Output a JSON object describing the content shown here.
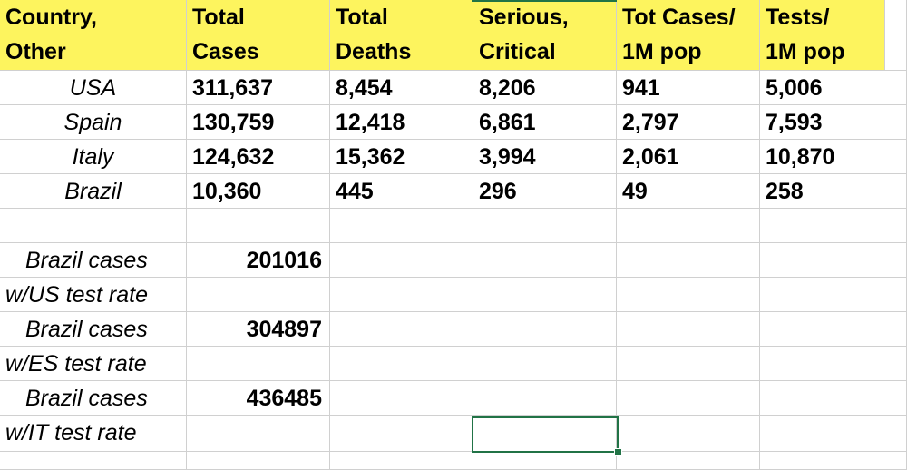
{
  "header": {
    "country": [
      "Country,",
      "Other"
    ],
    "total_cases": [
      "Total",
      "Cases"
    ],
    "total_deaths": [
      "Total",
      "Deaths"
    ],
    "serious": [
      "Serious,",
      "Critical"
    ],
    "tot_cases_1m": [
      "Tot Cases/",
      "1M pop"
    ],
    "tests_1m": [
      "Tests/",
      "1M pop"
    ]
  },
  "rows": [
    {
      "country": "USA",
      "total_cases": "311,637",
      "total_deaths": "8,454",
      "serious": "8,206",
      "tot_cases_1m": "941",
      "tests_1m": "5,006"
    },
    {
      "country": "Spain",
      "total_cases": "130,759",
      "total_deaths": "12,418",
      "serious": "6,861",
      "tot_cases_1m": "2,797",
      "tests_1m": "7,593"
    },
    {
      "country": "Italy",
      "total_cases": "124,632",
      "total_deaths": "15,362",
      "serious": "3,994",
      "tot_cases_1m": "2,061",
      "tests_1m": "10,870"
    },
    {
      "country": "Brazil",
      "total_cases": "10,360",
      "total_deaths": "445",
      "serious": "296",
      "tot_cases_1m": "49",
      "tests_1m": "258"
    }
  ],
  "estimates": [
    {
      "label1": "Brazil  cases",
      "label2": "w/US test rate",
      "value": "201016"
    },
    {
      "label1": "Brazil  cases",
      "label2": "w/ES test rate",
      "value": "304897"
    },
    {
      "label1": "Brazil  cases",
      "label2": "w/IT test rate",
      "value": "436485"
    }
  ],
  "colors": {
    "header_bg": "#fdf45e",
    "selection": "#217346",
    "gridline": "#d0d0d0"
  }
}
